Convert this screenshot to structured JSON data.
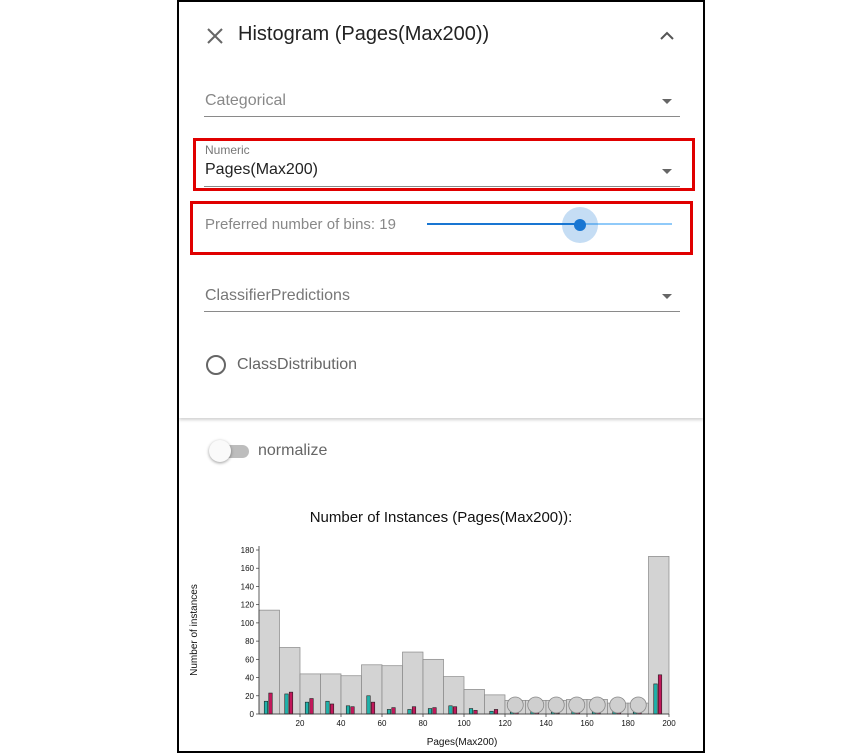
{
  "header": {
    "title": "Histogram (Pages(Max200))",
    "close_icon": "close-icon",
    "collapse_icon": "chevron-up-icon"
  },
  "categorical": {
    "placeholder": "Categorical"
  },
  "numeric": {
    "label": "Numeric",
    "value": "Pages(Max200)"
  },
  "bins": {
    "label": "Preferred number of bins: 19",
    "value": 19
  },
  "classifier": {
    "placeholder": "ClassifierPredictions"
  },
  "class_distribution": {
    "label": "ClassDistribution",
    "selected": false
  },
  "normalize": {
    "label": "normalize",
    "on": false
  },
  "colors": {
    "accent": "#1976d2",
    "highlight": "#e00000",
    "bar_fill": "#d3d3d3",
    "teal": "#20b2aa",
    "crimson": "#c2185b"
  },
  "chart_data": {
    "type": "bar",
    "title": "Number of Instances (Pages(Max200)):",
    "xlabel": "Pages(Max200)",
    "ylabel": "Number of instances",
    "xlim": [
      0,
      200
    ],
    "ylim": [
      0,
      180
    ],
    "yticks": [
      "0",
      "20",
      "40",
      "60",
      "80",
      "100",
      "120",
      "140",
      "160",
      "180"
    ],
    "xticks": [
      "20",
      "40",
      "60",
      "80",
      "100",
      "120",
      "140",
      "160",
      "180",
      "200"
    ],
    "bins": [
      {
        "x0": 0,
        "x1": 10,
        "v": 114,
        "a": 14,
        "b": 23
      },
      {
        "x0": 10,
        "x1": 20,
        "v": 73,
        "a": 22,
        "b": 24
      },
      {
        "x0": 20,
        "x1": 30,
        "v": 44,
        "a": 13,
        "b": 17
      },
      {
        "x0": 30,
        "x1": 40,
        "v": 44,
        "a": 14,
        "b": 11
      },
      {
        "x0": 40,
        "x1": 50,
        "v": 42,
        "a": 9,
        "b": 8
      },
      {
        "x0": 50,
        "x1": 60,
        "v": 54,
        "a": 20,
        "b": 13
      },
      {
        "x0": 60,
        "x1": 70,
        "v": 53,
        "a": 5,
        "b": 7
      },
      {
        "x0": 70,
        "x1": 80,
        "v": 68,
        "a": 5,
        "b": 8
      },
      {
        "x0": 80,
        "x1": 90,
        "v": 60,
        "a": 6,
        "b": 7
      },
      {
        "x0": 90,
        "x1": 100,
        "v": 41,
        "a": 9,
        "b": 8
      },
      {
        "x0": 100,
        "x1": 110,
        "v": 27,
        "a": 6,
        "b": 4
      },
      {
        "x0": 110,
        "x1": 120,
        "v": 21,
        "a": 3,
        "b": 5
      },
      {
        "x0": 120,
        "x1": 130,
        "v": 15,
        "a": 2,
        "b": 4
      },
      {
        "x0": 130,
        "x1": 140,
        "v": 15,
        "a": 3,
        "b": 4
      },
      {
        "x0": 140,
        "x1": 150,
        "v": 15,
        "a": 2,
        "b": 1
      },
      {
        "x0": 150,
        "x1": 160,
        "v": 16,
        "a": 5,
        "b": 4
      },
      {
        "x0": 160,
        "x1": 170,
        "v": 16,
        "a": 3,
        "b": 4
      },
      {
        "x0": 170,
        "x1": 180,
        "v": 12,
        "a": 3,
        "b": 2
      },
      {
        "x0": 180,
        "x1": 190,
        "v": 12,
        "a": 2,
        "b": 2
      },
      {
        "x0": 190,
        "x1": 200,
        "v": 173,
        "a": 33,
        "b": 43
      }
    ],
    "markers": [
      125,
      135,
      145,
      155,
      165,
      175,
      185
    ]
  }
}
